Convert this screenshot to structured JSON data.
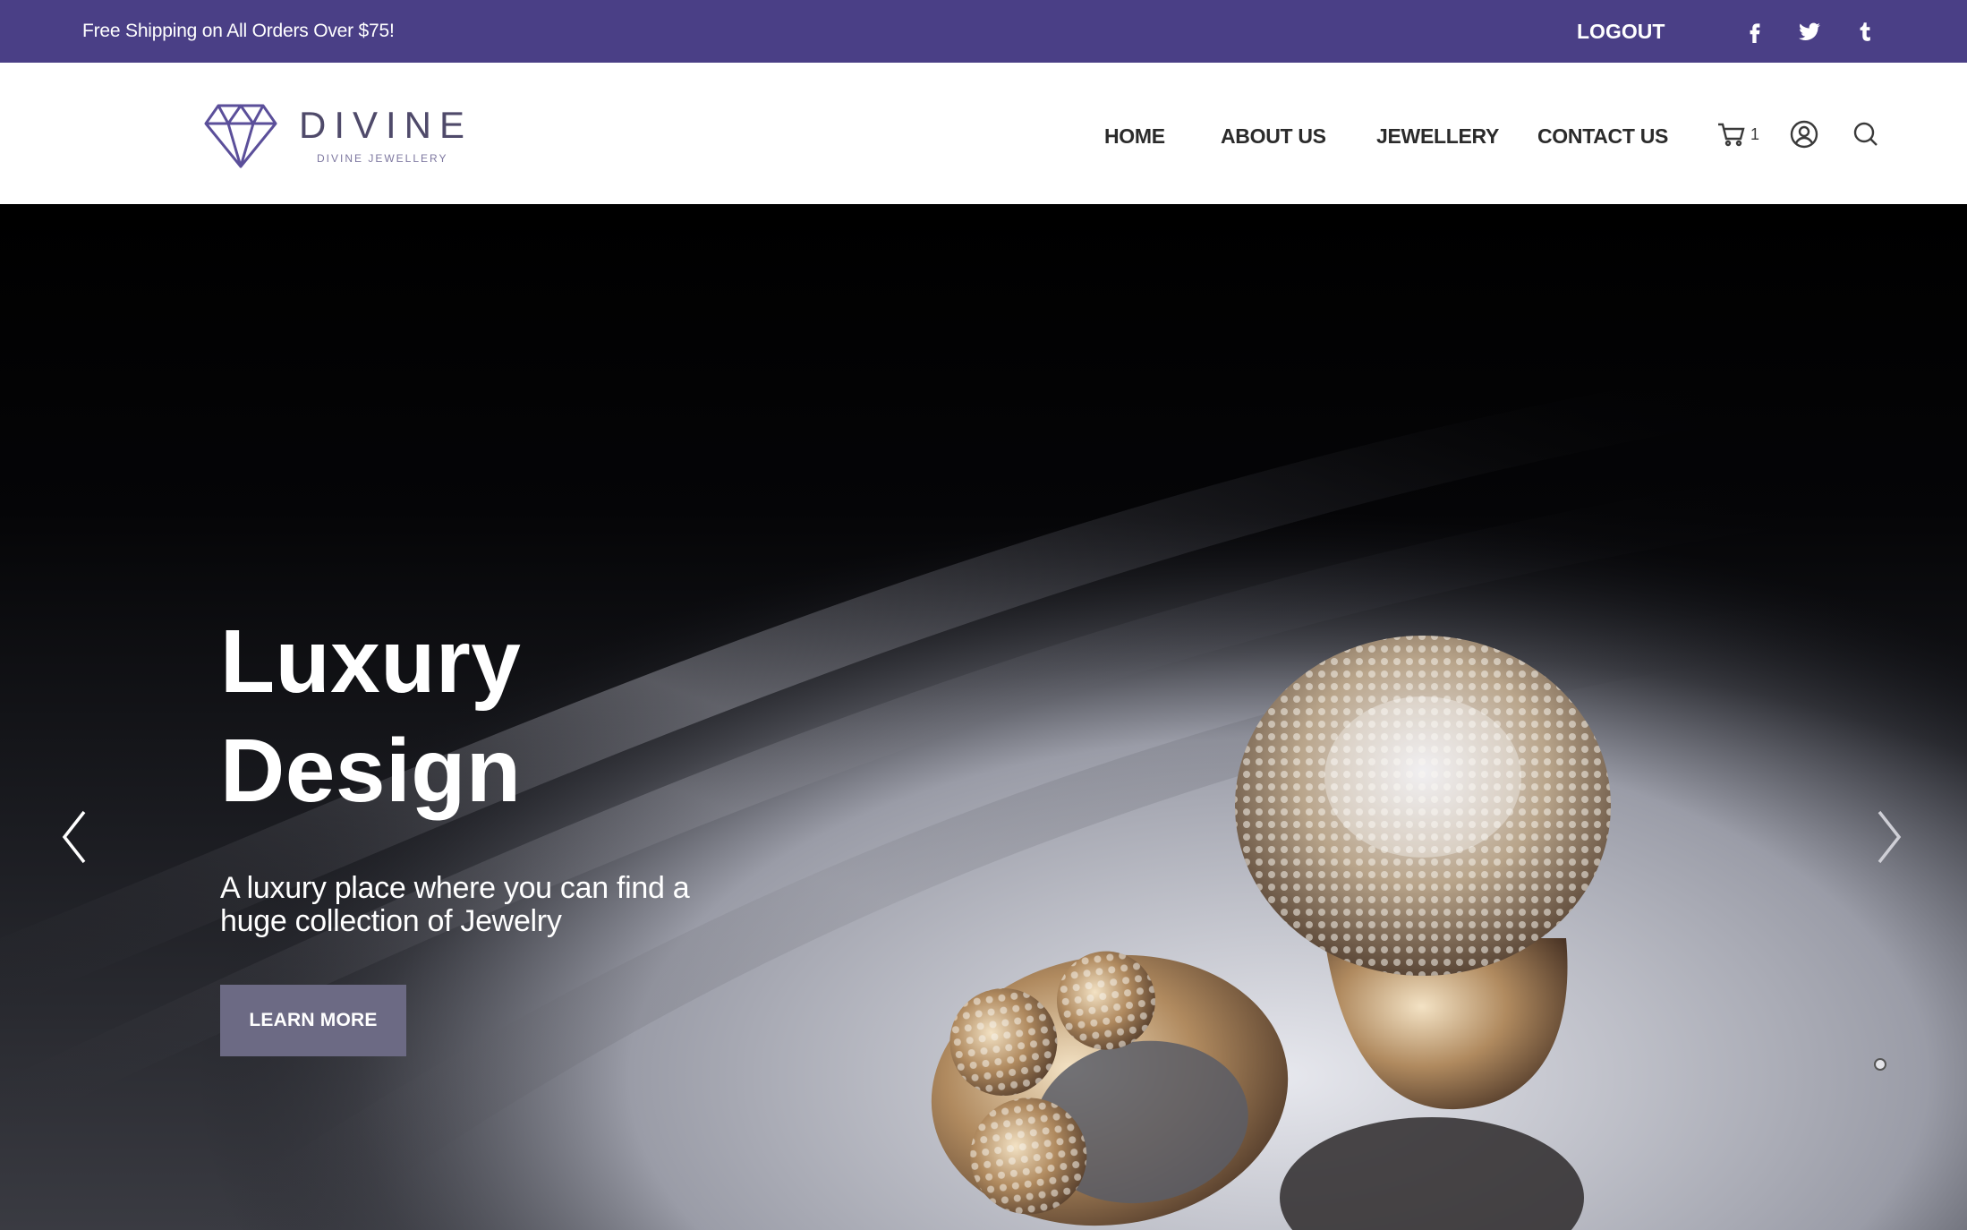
{
  "topbar": {
    "promo_text": "Free Shipping on All Orders Over $75!",
    "logout_label": "LOGOUT",
    "social": [
      "facebook-icon",
      "twitter-icon",
      "tumblr-icon"
    ],
    "background_color": "#4a3f86"
  },
  "header": {
    "logo": {
      "name": "DIVINE",
      "tagline": "DIVINE JEWELLERY",
      "icon": "diamond-icon"
    },
    "nav": [
      {
        "label": "HOME"
      },
      {
        "label": "ABOUT US"
      },
      {
        "label": "JEWELLERY"
      },
      {
        "label": "CONTACT US"
      }
    ],
    "cart": {
      "icon": "cart-icon",
      "count": "1"
    },
    "account_icon": "user-circle-icon",
    "search_icon": "search-icon"
  },
  "hero": {
    "title_line1": "Luxury",
    "title_line2": "Design",
    "subtitle_line1": "A luxury place where you can find a",
    "subtitle_line2": "huge collection of Jewelry",
    "cta_label": "LEARN MORE",
    "cta_color": "#6c6a84",
    "prev_icon": "chevron-left-icon",
    "next_icon": "chevron-right-icon"
  }
}
